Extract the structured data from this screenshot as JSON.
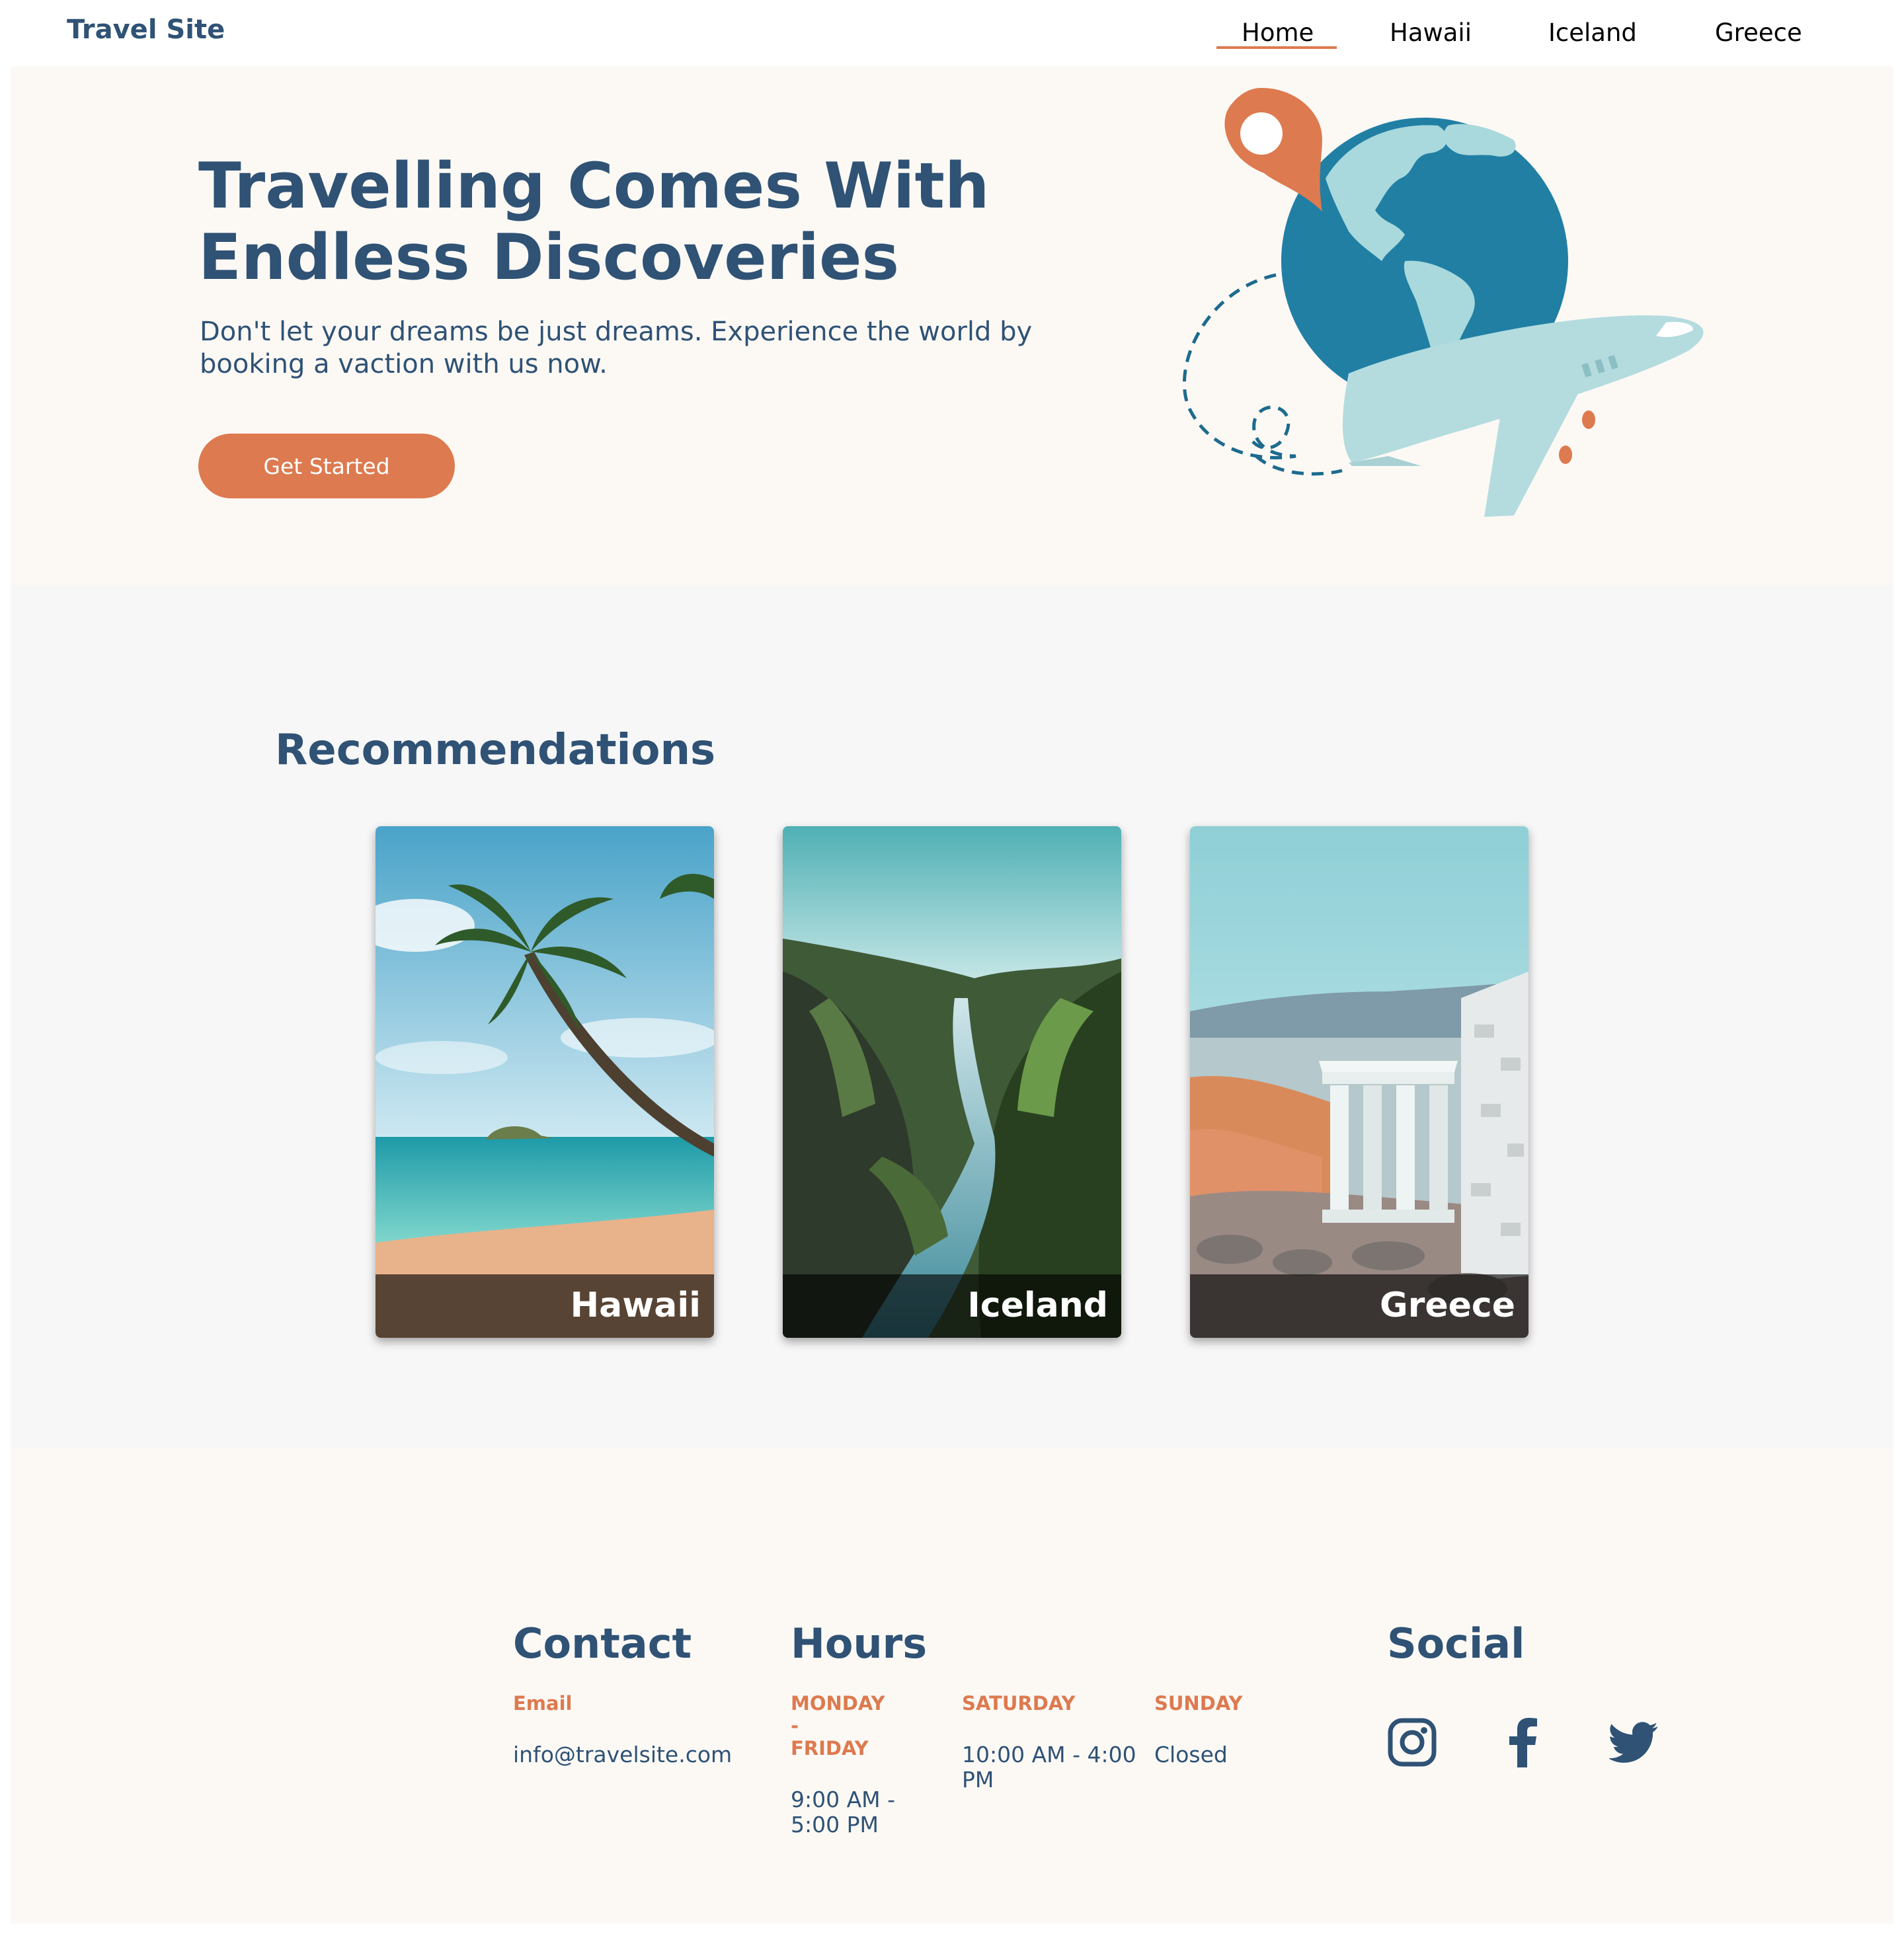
{
  "nav": {
    "logo": "Travel Site",
    "links": [
      {
        "label": "Home",
        "active": true
      },
      {
        "label": "Hawaii"
      },
      {
        "label": "Iceland"
      },
      {
        "label": "Greece"
      }
    ]
  },
  "hero": {
    "title_line1": "Travelling Comes With",
    "title_line2": "Endless Discoveries",
    "subtitle_line1": "Don't let your dreams be just dreams. Experience the world by",
    "subtitle_line2": "booking a vaction with us now.",
    "cta_label": "Get Started",
    "illustration": "globe-airplane-location-pin"
  },
  "recommendations": {
    "title": "Recommendations",
    "cards": [
      {
        "label": "Hawaii",
        "image": "palm-tree-beach"
      },
      {
        "label": "Iceland",
        "image": "mossy-canyon-river"
      },
      {
        "label": "Greece",
        "image": "ancient-temple-ruins"
      }
    ]
  },
  "footer": {
    "contact": {
      "title": "Contact",
      "email_label": "Email",
      "email": "info@travelsite.com"
    },
    "hours": {
      "title": "Hours",
      "columns": [
        {
          "day_line1": "MONDAY",
          "day_line2": "-",
          "day_line3": "FRIDAY",
          "time_line1": "9:00 AM -",
          "time_line2": "5:00 PM"
        },
        {
          "day_line1": "SATURDAY",
          "time_line1": "10:00 AM - 4:00",
          "time_line2": "PM"
        },
        {
          "day_line1": "SUNDAY",
          "time_line1": "Closed"
        }
      ]
    },
    "social": {
      "title": "Social",
      "icons": [
        "instagram-icon",
        "facebook-icon",
        "twitter-icon"
      ]
    }
  },
  "colors": {
    "primary": "#2f5275",
    "accent": "#dd7a4f",
    "hero_bg": "#fcf9f5",
    "section_bg": "#f7f7f7",
    "globe_ocean": "#217fa4",
    "globe_land": "#a9d9dc"
  }
}
